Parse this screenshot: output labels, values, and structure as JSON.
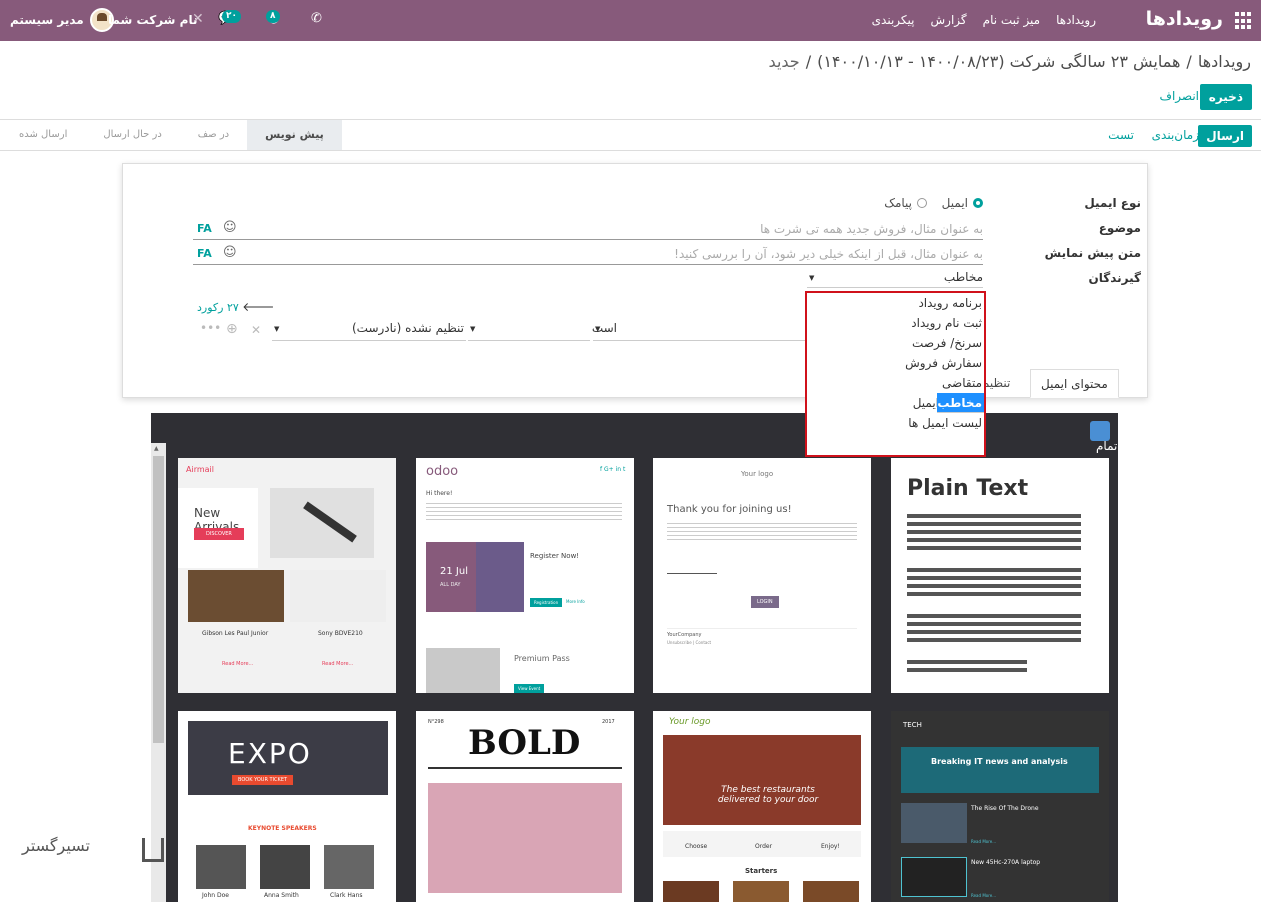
{
  "navbar": {
    "app_title": "رویدادها",
    "menu": [
      "رویدادها",
      "میز ثبت نام",
      "گزارش",
      "پیکربندی"
    ],
    "user_name": "مدیر سیستم",
    "company": "نام شرکت شما",
    "chat_badge": "۲۰",
    "activity_badge": "۸"
  },
  "breadcrumb": {
    "root": "رویدادها",
    "event": "همایش ۲۳ سالگی شرکت (۱۴۰۰/۰۸/۲۳ - ۱۴۰۰/۱۰/۱۳)",
    "current": "جدید",
    "sep": "/"
  },
  "buttons": {
    "save": "ذخیره",
    "discard": "انصراف"
  },
  "statusbar": {
    "send": "ارسال",
    "schedule": "زمان‌بندی",
    "test": "تست",
    "stages": [
      "پیش نویس",
      "در صف",
      "در حال ارسال",
      "ارسال شده"
    ]
  },
  "form": {
    "type_label": "نوع ایمیل",
    "type_email": "ایمیل",
    "type_sms": "پیامک",
    "subject_label": "موضوع",
    "subject_placeholder": "به عنوان مثال، فروش جدید همه تی شرت ها",
    "preview_label": "متن پیش نمایش",
    "preview_placeholder": "به عنوان مثال، قبل از اینکه خیلی دیر شود، آن را بررسی کنید!",
    "lang_code": "FA",
    "recipients_label": "گیرندگان",
    "recipients_value": "مخاطب",
    "records": "۲۷ رکورد",
    "filter_op": "است",
    "filter_value": "تنظیم نشده (نادرست)"
  },
  "tabs": {
    "content": "محتوای ایمیل",
    "settings": "تنظیمات"
  },
  "dropdown": {
    "options": [
      "برنامه رویداد",
      "ثبت نام رویداد",
      "سرنخ/ فرصت",
      "سفارش فروش",
      "متقاضی",
      "مخاطب",
      "مخاطب ایمیل",
      "لیست ایمیل ها"
    ],
    "selected": "مخاطب"
  },
  "gallery": {
    "fullscreen_label": "تمام",
    "cards": {
      "airmail": {
        "brand": "Airmail",
        "headline": "New Arrivals",
        "cta": "DISCOVER",
        "p1": "Gibson Les Paul Junior",
        "p2": "Sony BDVE210",
        "more": "Read More..."
      },
      "odoo": {
        "brand": "odoo",
        "greet": "Hi there!",
        "date": "21 Jul",
        "allday": "ALL DAY",
        "reg": "Register Now!",
        "reg_btn": "Registration",
        "more_info": "More Info",
        "premium": "Premium Pass",
        "view": "View Event"
      },
      "logo": {
        "logo": "Your logo",
        "thanks": "Thank you for joining us!",
        "btn": "LOGIN",
        "company": "YourCompany",
        "unsub": "Unsubscribe | Contact"
      },
      "plain": {
        "title": "Plain Text"
      },
      "expo": {
        "title": "EXPO",
        "btn": "BOOK YOUR TICKET",
        "section": "KEYNOTE SPEAKERS",
        "s1": "John Doe",
        "s2": "Anna Smith",
        "s3": "Clark Hans"
      },
      "bold": {
        "title": "BOLD",
        "num": "N°298",
        "year": "2017"
      },
      "food": {
        "logo": "Your logo",
        "tagline": "The best restaurants delivered to your door",
        "step1": "Choose",
        "step2": "Order",
        "step3": "Enjoy!",
        "section": "Starters"
      },
      "tech": {
        "brand": "TECH",
        "headline": "Breaking IT news and analysis",
        "a1": "The Rise Of The Drone",
        "a2": "New 45Hc-270A laptop",
        "more": "Read More..."
      }
    }
  },
  "watermark": "تسیرگستر"
}
